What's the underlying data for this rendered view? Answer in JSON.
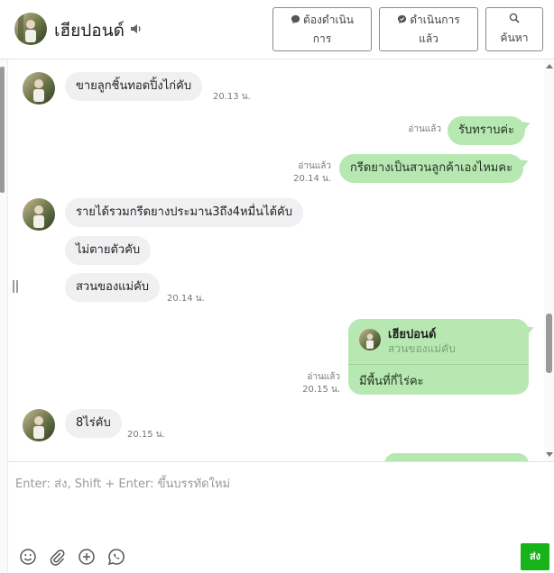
{
  "header": {
    "contact_name": "เฮียปอนด์",
    "buttons": [
      {
        "label_line1": "ต้องดำเนิน",
        "label_line2": "การ",
        "icon": "chat-bubble-icon"
      },
      {
        "label_line1": "ดำเนินการ",
        "label_line2": "แล้ว",
        "icon": "check-bubble-icon"
      },
      {
        "label_line1": "",
        "label_line2": "ค้นหา",
        "icon": "search-icon"
      }
    ]
  },
  "messages": [
    {
      "side": "in",
      "text": "ขายลูกชิ้นทอดปิ้งไก่คับ",
      "time": "20.13 น."
    },
    {
      "side": "out",
      "text": "รับทราบค่ะ",
      "read": "อ่านแล้ว"
    },
    {
      "side": "out",
      "text": "กรีดยางเป็นสวนลูกค้าเองไหมคะ",
      "read": "อ่านแล้ว",
      "time": "20.14 น."
    },
    {
      "side": "in",
      "text": "รายได้รวมกรีดยางประมาน3ถึง4หมื่นได้คับ"
    },
    {
      "side": "in",
      "text": "ไม่ตายตัวคับ"
    },
    {
      "side": "in",
      "text": "สวนของแม่คับ",
      "time": "20.14 น."
    },
    {
      "side": "out",
      "reply_to_name": "เฮียปอนด์",
      "reply_to_text": "สวนของแม่คับ",
      "text": "มีพื้นที่กี่ไร่คะ",
      "read": "อ่านแล้ว",
      "time": "20.15 น."
    },
    {
      "side": "in",
      "text": "8ไร่คับ",
      "time": "20.15 น."
    }
  ],
  "composer": {
    "placeholder": "Enter: ส่ง, Shift + Enter: ขึ้นบรรทัดใหม่",
    "send_label": "ส่ง",
    "tools": [
      "emoji-icon",
      "attachment-icon",
      "sticker-add-icon",
      "whatsapp-icon"
    ]
  },
  "colors": {
    "outgoing_bubble": "#b8e8b2",
    "incoming_bubble": "#f0f0f2",
    "send_button": "#17b319"
  }
}
